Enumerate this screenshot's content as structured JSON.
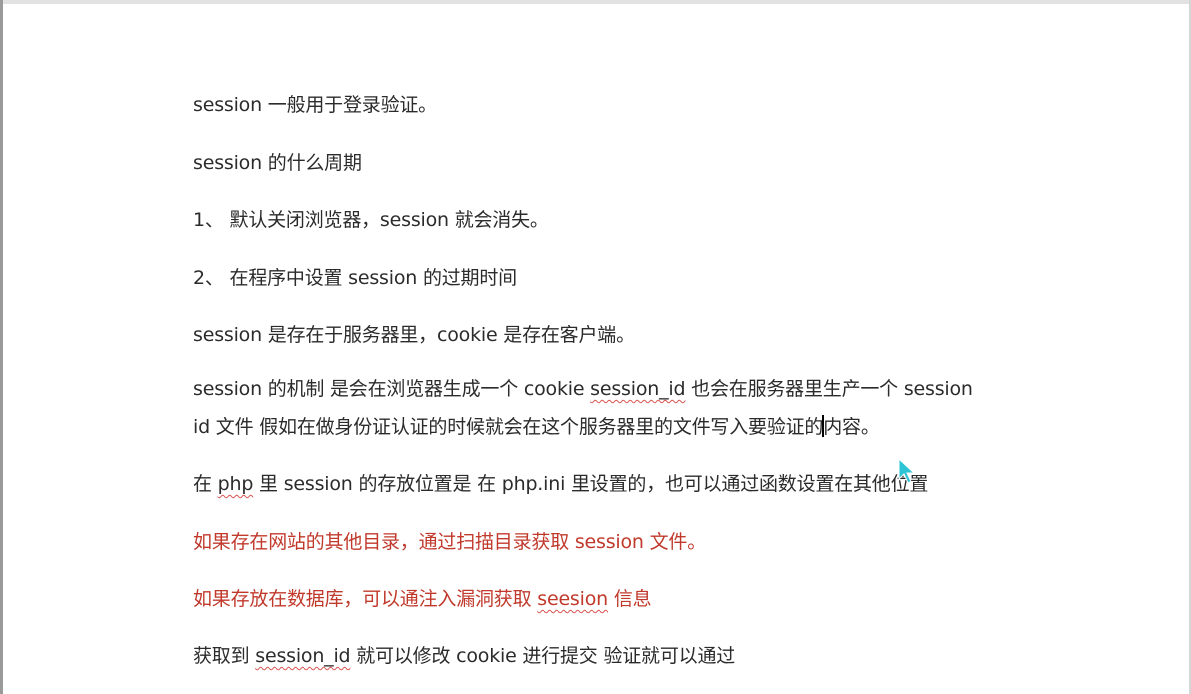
{
  "document": {
    "p1": "session 一般用于登录验证。",
    "p2": "session 的什么周期",
    "p3": "1、 默认关闭浏览器，session 就会消失。",
    "p4": "2、 在程序中设置 session 的过期时间",
    "p5": "session 是存在于服务器里，cookie 是存在客户端。",
    "p6": {
      "a": "session 的机制  是会在浏览器生成一个 cookie  ",
      "b": "session_id",
      "c": "   也会在服务器里生产一个 session"
    },
    "p6b": {
      "a": "id 文件 假如在做身份证认证的时候就会在这个服务器里的文件写入要验证的",
      "b": "内容。"
    },
    "p7": {
      "a": "在 ",
      "b": "php",
      "c": " 里  session 的存放位置是  在 php.ini 里设置的，也可以通过函数设置在其他位置"
    },
    "p8": "如果存在网站的其他目录，通过扫描目录获取  session  文件。",
    "p9": {
      "a": "如果存放在数据库，可以通注入漏洞获取 ",
      "b": "seesion",
      "c": " 信息"
    },
    "p10": {
      "a": "获取到 ",
      "b": "session_id",
      "c": "  就可以修改 cookie  进行提交 验证就可以通过"
    }
  },
  "colors": {
    "text": "#2b2b2b",
    "red_text": "#c0392b",
    "spellcheck_underline": "#d9534f",
    "cursor": "#2ec4d6"
  },
  "icons": {
    "mouse_pointer": "arrow-pointer-icon"
  }
}
